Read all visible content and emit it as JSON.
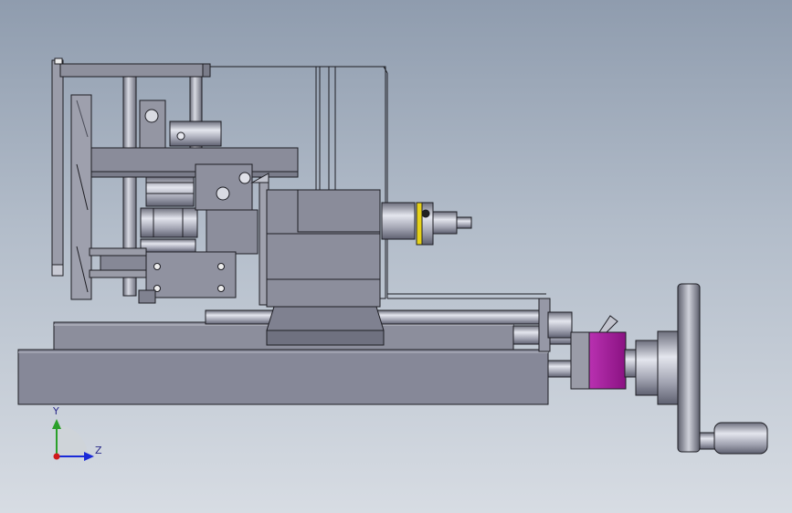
{
  "viewport": {
    "background_top": "#8f9cae",
    "background_bottom": "#d7dce3"
  },
  "model": {
    "part_color": "#8a8c9c",
    "edge_color": "#1e1e24",
    "highlight_color": "#c6c8d2",
    "accent_magenta": "#b01aa8",
    "accent_yellow": "#e6d21a"
  },
  "triad": {
    "y_label": "Y",
    "z_label": "Z",
    "y_color": "#2aa02a",
    "z_color": "#1a2ad8",
    "x_color": "#d01a1a"
  }
}
